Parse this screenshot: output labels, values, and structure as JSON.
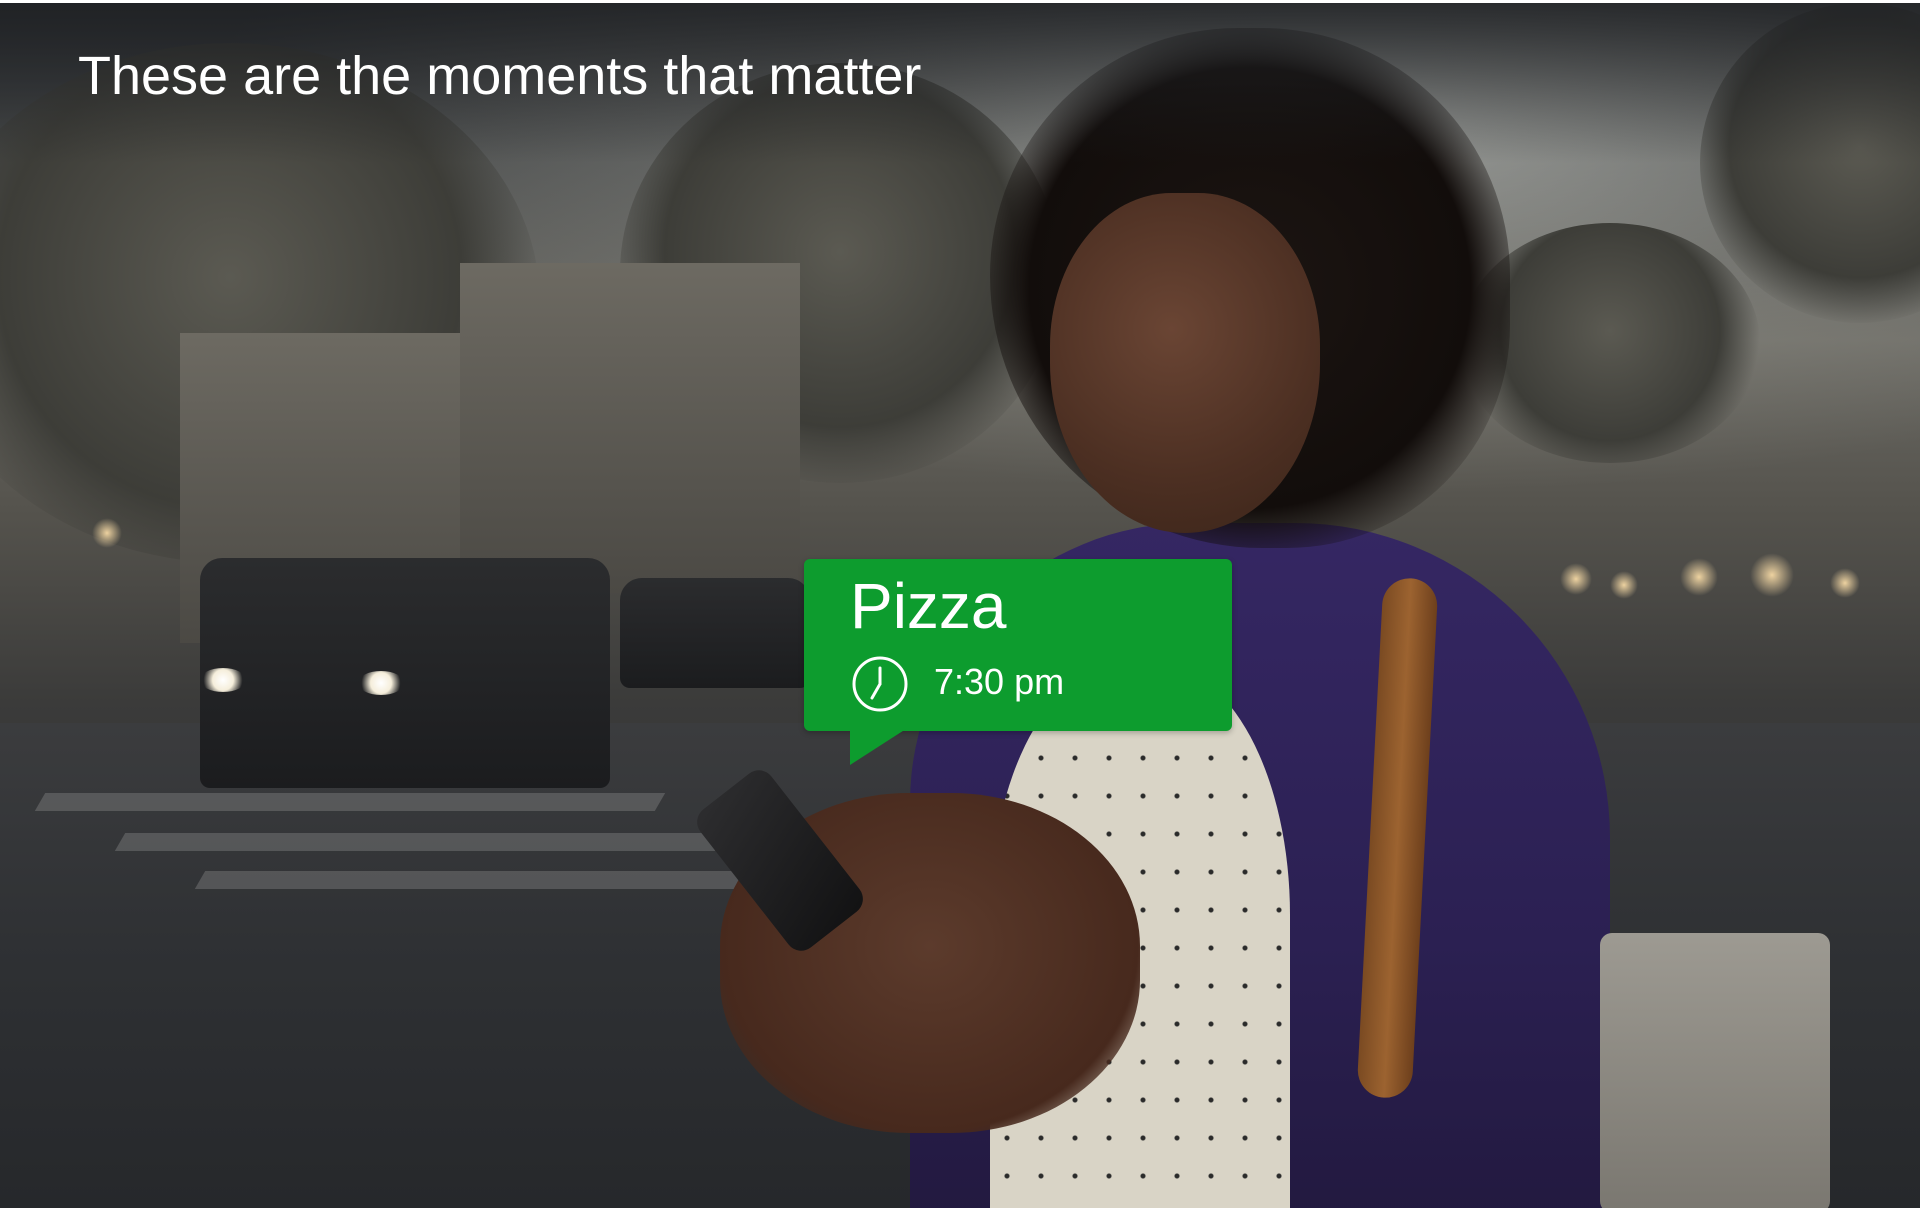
{
  "slide": {
    "headline": "These are the moments that matter"
  },
  "reminder": {
    "title": "Pizza",
    "time": "7:30 pm",
    "icon": "clock-icon",
    "color": "#0d9c2e"
  },
  "photo": {
    "subject": "photo-background"
  }
}
